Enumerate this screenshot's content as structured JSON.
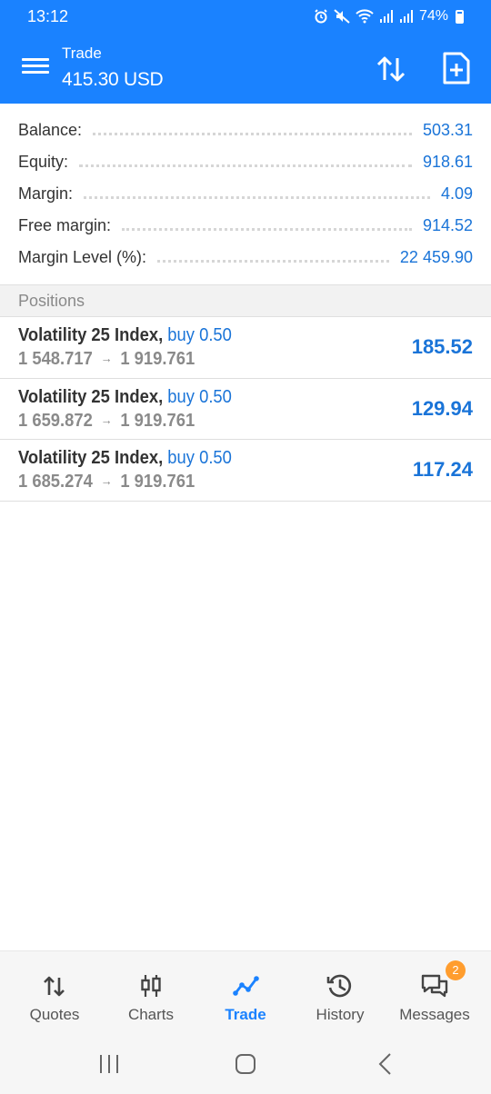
{
  "status_bar": {
    "time": "13:12",
    "battery": "74%",
    "icons": [
      "alarm-icon",
      "mute-icon",
      "wifi-icon",
      "signal-icon",
      "signal-icon",
      "battery-icon"
    ]
  },
  "header": {
    "title": "Trade",
    "subtitle": "415.30 USD",
    "icons": [
      "menu-icon",
      "sort-icon",
      "new-order-icon"
    ]
  },
  "account": {
    "rows": [
      {
        "label": "Balance:",
        "value": "503.31"
      },
      {
        "label": "Equity:",
        "value": "918.61"
      },
      {
        "label": "Margin:",
        "value": "4.09"
      },
      {
        "label": "Free margin:",
        "value": "914.52"
      },
      {
        "label": "Margin Level (%):",
        "value": "22 459.90"
      }
    ]
  },
  "positions": {
    "header": "Positions",
    "rows": [
      {
        "symbol": "Volatility 25 Index,",
        "side": "buy 0.50",
        "open_price": "1 548.717",
        "arrow": "→",
        "current_price": "1 919.761",
        "profit": "185.52"
      },
      {
        "symbol": "Volatility 25 Index,",
        "side": "buy 0.50",
        "open_price": "1 659.872",
        "arrow": "→",
        "current_price": "1 919.761",
        "profit": "129.94"
      },
      {
        "symbol": "Volatility 25 Index,",
        "side": "buy 0.50",
        "open_price": "1 685.274",
        "arrow": "→",
        "current_price": "1 919.761",
        "profit": "117.24"
      }
    ]
  },
  "bottom_nav": {
    "items": [
      {
        "label": "Quotes",
        "icon": "quotes-icon",
        "active": false
      },
      {
        "label": "Charts",
        "icon": "charts-icon",
        "active": false
      },
      {
        "label": "Trade",
        "icon": "trade-icon",
        "active": true
      },
      {
        "label": "History",
        "icon": "history-icon",
        "active": false
      },
      {
        "label": "Messages",
        "icon": "messages-icon",
        "active": false,
        "badge": "2"
      }
    ]
  },
  "system_nav": {
    "icons": [
      "recent-apps-icon",
      "home-icon",
      "back-icon"
    ]
  },
  "colors": {
    "accent": "#1a82ff",
    "value_blue": "#1a74d8",
    "badge": "#ff9d2e"
  }
}
